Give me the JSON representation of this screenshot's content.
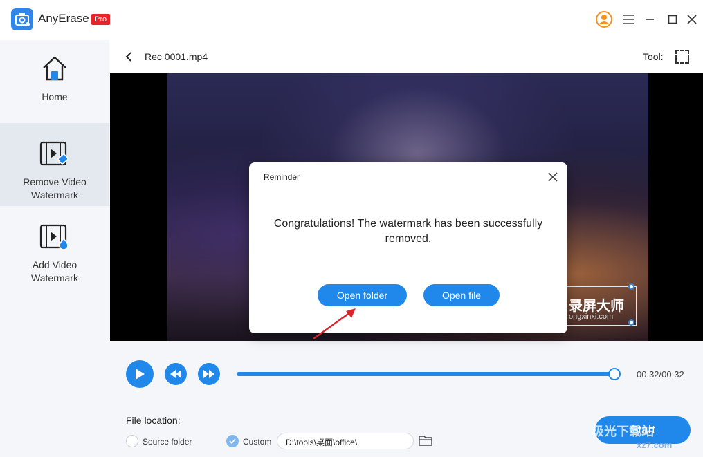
{
  "app": {
    "name": "AnyErase",
    "badge": "Pro"
  },
  "sidebar": {
    "items": [
      {
        "label": "Home",
        "icon": "home-icon"
      },
      {
        "label": "Remove Video Watermark",
        "icon": "remove-video-watermark-icon",
        "active": true
      },
      {
        "label": "Add Video Watermark",
        "icon": "add-video-watermark-icon"
      }
    ]
  },
  "header": {
    "file_name": "Rec 0001.mp4",
    "tool_label": "Tool:"
  },
  "video": {
    "watermark_text": "录屏大师",
    "watermark_sub": "ongxinxi.com"
  },
  "player": {
    "time": "00:32/00:32",
    "progress": 1.0
  },
  "file_location": {
    "label": "File location:",
    "source_folder_label": "Source folder",
    "custom_label": "Custom",
    "custom_path": "D:\\tools\\桌面\\office\\",
    "selected": "custom"
  },
  "start_label": "Start",
  "modal": {
    "title": "Reminder",
    "message": "Congratulations! The watermark has been successfully removed.",
    "open_folder_label": "Open folder",
    "open_file_label": "Open file"
  },
  "site_watermark": {
    "text": "极光下载站",
    "sub": "xz7.com"
  },
  "colors": {
    "accent": "#1f88ea",
    "badge": "#e8242a"
  }
}
